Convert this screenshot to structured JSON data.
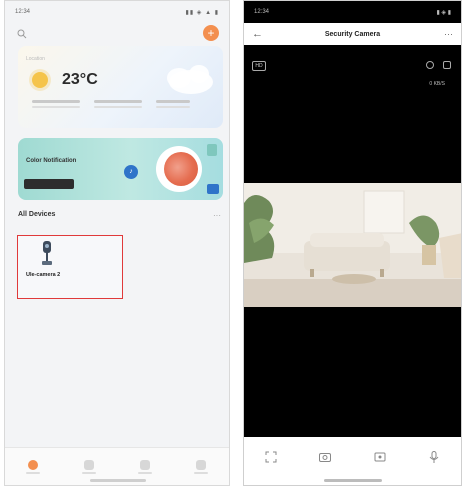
{
  "left_screen": {
    "status_time": "12:34",
    "status_icons": "▮▮ ◈ ▲ ▮",
    "weather": {
      "location": "Location",
      "temperature": "23°C",
      "icon": "sun-icon"
    },
    "promo": {
      "title": "Color Notification",
      "action_icon": "bell-icon"
    },
    "section_title": "All Devices",
    "section_more": "···",
    "device": {
      "name": "Ule-camera 2",
      "icon": "camera-icon"
    },
    "nav_items": [
      "home",
      "devices",
      "scenes",
      "me"
    ]
  },
  "right_screen": {
    "status_time": "12:34",
    "status_icons": "▮ ◈ ▮",
    "title": "Security Camera",
    "back_label": "←",
    "more_label": "···",
    "hd_label": "HD",
    "rate_label": "0 KB/S",
    "toolbar_icons": [
      "fullscreen-icon",
      "snapshot-icon",
      "record-icon",
      "talk-icon"
    ]
  },
  "colors": {
    "accent": "#f38f4f",
    "selection": "#e03a3a"
  }
}
